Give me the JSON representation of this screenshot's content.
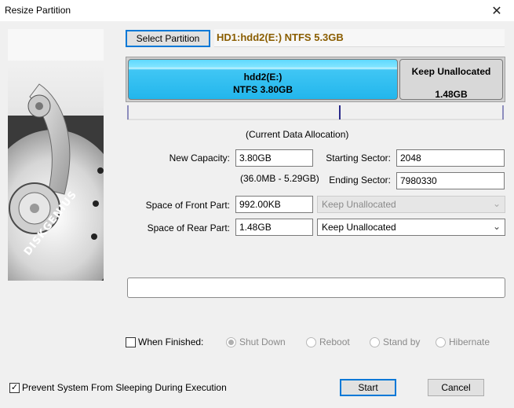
{
  "window": {
    "title": "Resize Partition",
    "close_glyph": "✕"
  },
  "side_art": {
    "brand": "DISKGENIUS",
    "icon": "hard-disk-platter-art"
  },
  "header": {
    "select_partition_label": "Select Partition",
    "partition_info": "HD1:hdd2(E:) NTFS 5.3GB"
  },
  "partition_bar": {
    "main": {
      "name": "hdd2(E:)",
      "detail": "NTFS 3.80GB"
    },
    "unallocated": {
      "label": "Keep Unallocated",
      "size": "1.48GB"
    },
    "allocation_caption": "(Current Data Allocation)"
  },
  "form": {
    "new_capacity_label": "New Capacity:",
    "new_capacity_value": "3.80GB",
    "capacity_range": "(36.0MB - 5.29GB)",
    "starting_sector_label": "Starting Sector:",
    "starting_sector_value": "2048",
    "ending_sector_label": "Ending Sector:",
    "ending_sector_value": "7980330",
    "front_label": "Space of Front Part:",
    "front_value": "992.00KB",
    "front_option": "Keep Unallocated",
    "rear_label": "Space of Rear Part:",
    "rear_value": "1.48GB",
    "rear_option": "Keep Unallocated"
  },
  "finish": {
    "when_finished_label": "When Finished:",
    "options": [
      "Shut Down",
      "Reboot",
      "Stand by",
      "Hibernate"
    ],
    "selected": "Shut Down"
  },
  "footer": {
    "prevent_sleep_label": "Prevent System From Sleeping During Execution",
    "prevent_sleep_checked": "✓",
    "start_label": "Start",
    "cancel_label": "Cancel"
  },
  "colors": {
    "partition_fill": "#22b6ec",
    "header_text": "#8a5d00",
    "focus_border": "#0078d7"
  }
}
